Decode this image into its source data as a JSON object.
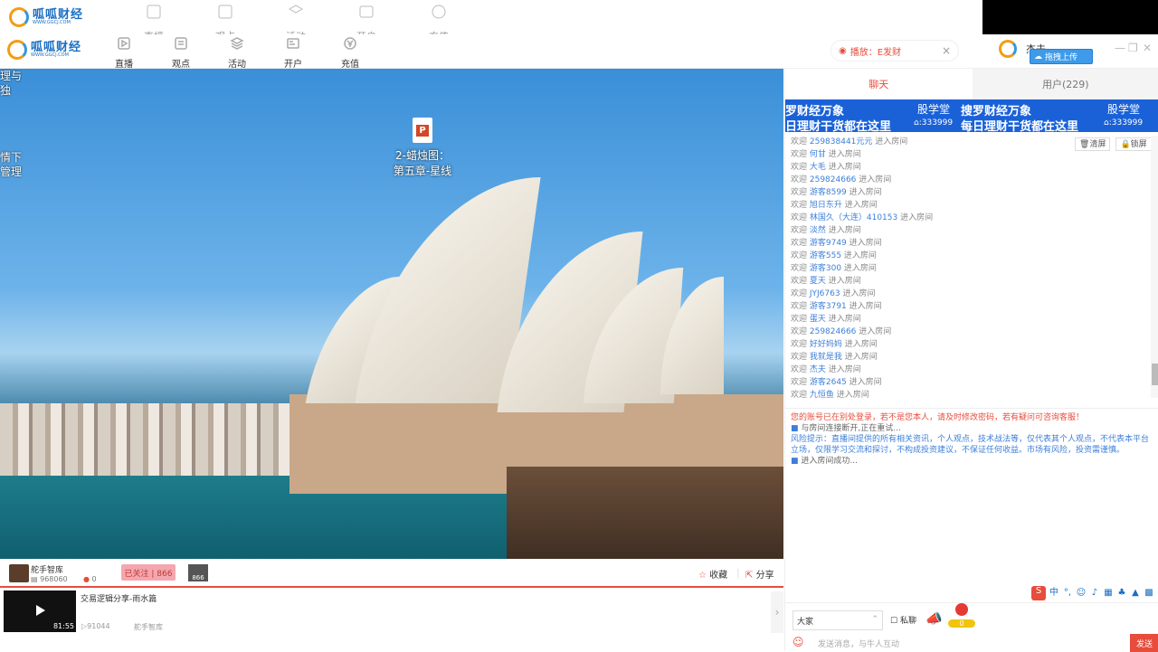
{
  "ghost_header": {
    "logo_name": "呱呱财经",
    "logo_url": "WWW.GGCJ.COM",
    "nav": [
      "直播",
      "观点",
      "活动",
      "开户",
      "充值"
    ]
  },
  "header": {
    "logo_name": "呱呱财经",
    "logo_url": "WWW.GGCJ.COM",
    "nav": [
      {
        "label": "直播",
        "icon": "live-icon"
      },
      {
        "label": "观点",
        "icon": "viewpoint-icon"
      },
      {
        "label": "活动",
        "icon": "layers-icon"
      },
      {
        "label": "开户",
        "icon": "account-icon"
      },
      {
        "label": "充值",
        "icon": "yen-icon"
      }
    ],
    "playing_label": "播放：E发财",
    "user_name": "杰夫",
    "upload_label": "拖拽上传"
  },
  "video": {
    "desktop_left_1": "理与",
    "desktop_left_2": "独",
    "desktop_left_3": "情下",
    "desktop_left_4": "管理",
    "file_label_1": "2-蜡烛图：",
    "file_label_2": "第五章-星线"
  },
  "streamer": {
    "name": "舵手智库",
    "fans": "968060",
    "gifts": "0",
    "follow_label": "已关注 | 866",
    "mini_count": "866",
    "collect_label": "收藏",
    "share_label": "分享"
  },
  "bottom": {
    "video_title": "交易逻辑分享-雨水篇",
    "views": "91044",
    "author": "舵手智库",
    "duration": "81:55"
  },
  "panel": {
    "tab_chat": "聊天",
    "tab_users": "用户(229)",
    "banner_text_1": "罗财经万象",
    "banner_text_2": "日理财干货都在这里",
    "banner_text_3": "股学堂",
    "banner_text_4": "搜罗财经万象",
    "banner_text_5": "每日理财干货都在这里",
    "banner_text_6": "股学堂",
    "banner_count": ":333999",
    "clear_label": "清屏",
    "lock_label": "锁屏",
    "welcome_prefix": "欢迎",
    "welcome_suffix": "进入房间",
    "chat_users": [
      "259838441元元",
      "何甘",
      "大毛",
      "259824666",
      "游客8599",
      "旭日东升",
      "林国久（大连）410153",
      "淡然",
      "游客9749",
      "游客555",
      "游客300",
      "夏天",
      "JYJ6763",
      "游客3791",
      "蛋天",
      "259824666",
      "好好妈妈",
      "我就是我",
      "杰夫",
      "游客2645",
      "九恒鱼"
    ],
    "sys_warning": "您的账号已在别处登录，若不是您本人，请及时修改密码，若有疑问可咨询客服！",
    "sys_reconnect": "与房间连接断开,正在重试...",
    "sys_risk": "风险提示：直播间提供的所有相关资讯，个人观点，技术战法等，仅代表其个人观点，不代表本平台立场，仅限学习交流和探讨，不构成投资建议，不保证任何收益。市场有风险，投资需谨慎。",
    "sys_enter": "进入房间成功...",
    "target": "大家",
    "private_label": "私聊",
    "gift_count": "0",
    "input_placeholder": "发送消息，与牛人互动",
    "send_label": "发送"
  }
}
